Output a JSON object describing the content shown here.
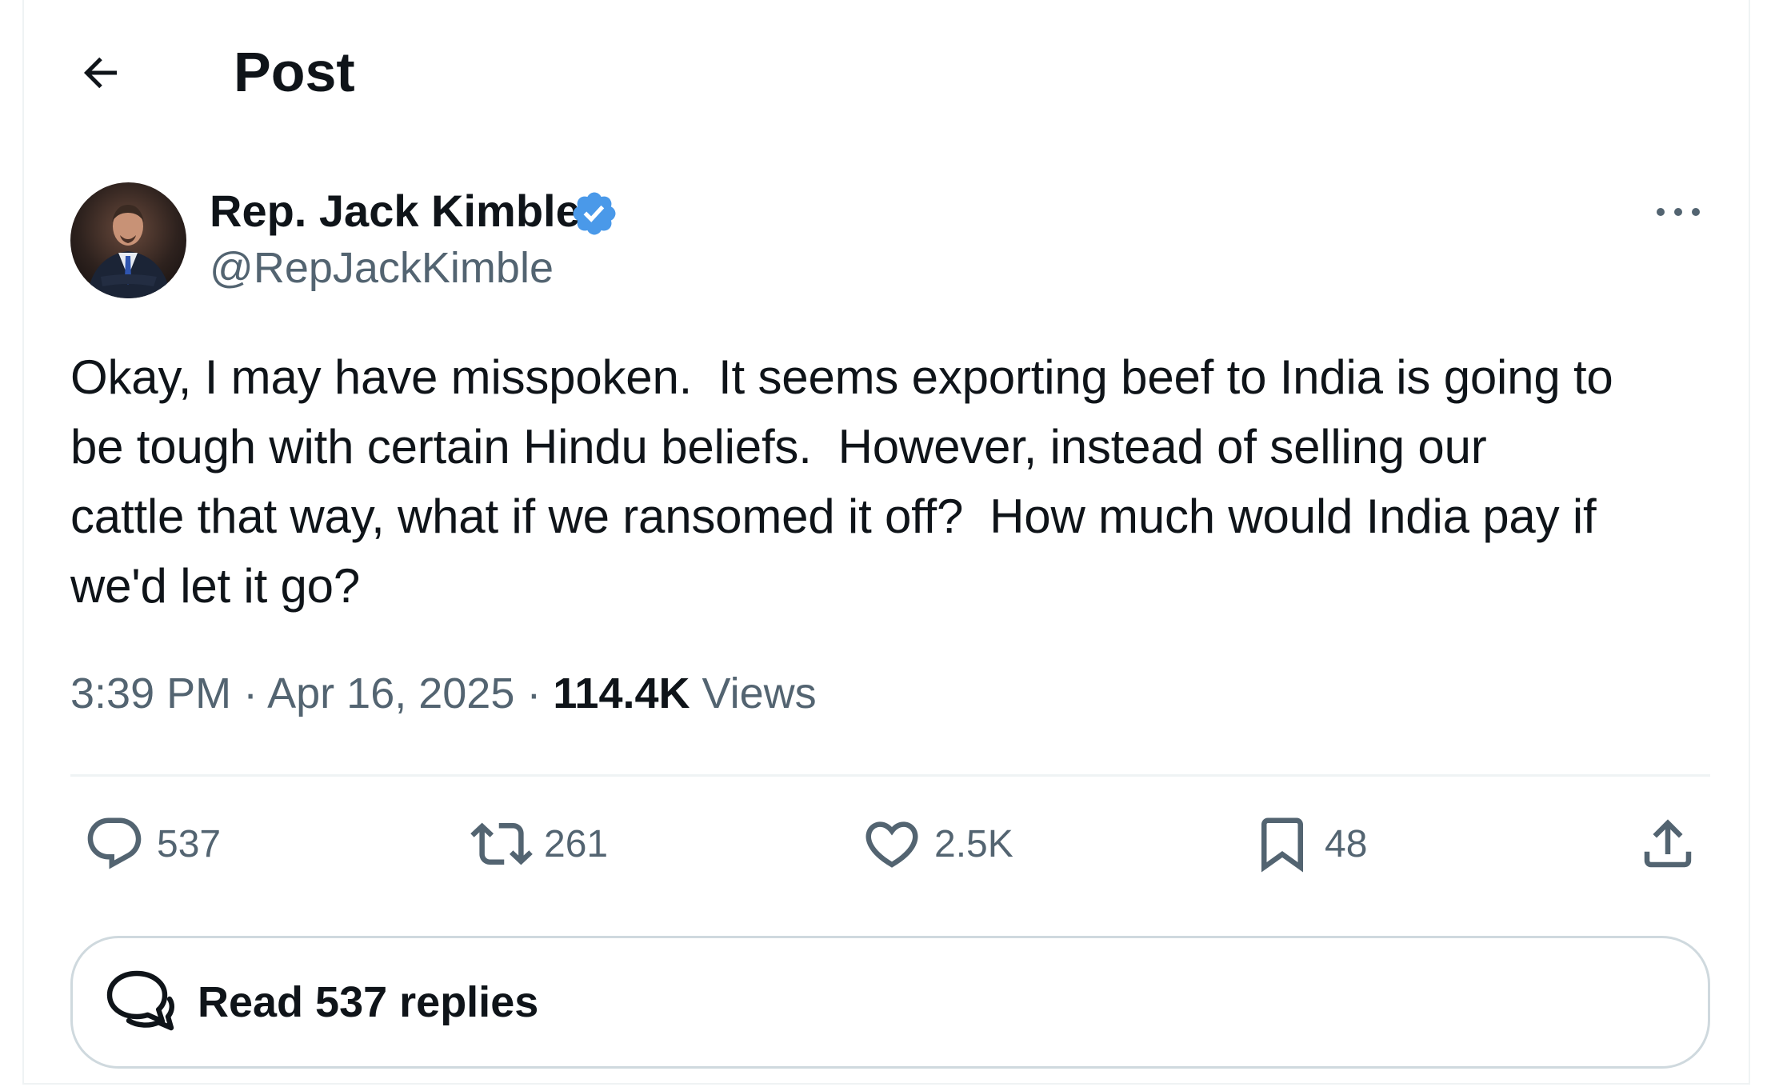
{
  "header": {
    "title": "Post",
    "back_icon": "arrow-left-icon"
  },
  "author": {
    "display_name": "Rep. Jack Kimble",
    "handle": "@RepJackKimble",
    "verified": true,
    "verified_color": "#4a99e9"
  },
  "tweet": {
    "text": "Okay, I may have misspoken.  It seems exporting beef to India is going to\nbe tough with certain Hindu beliefs.  However, instead of selling our\ncattle that way, what if we ransomed it off?  How much would India pay if\nwe'd let it go?",
    "time": "3:39 PM",
    "separator": " · ",
    "date": "Apr 16, 2025",
    "views_count": "114.4K",
    "views_label": "Views"
  },
  "actions": {
    "replies": "537",
    "reposts": "261",
    "likes": "2.5K",
    "bookmarks": "48"
  },
  "read_replies": {
    "label": "Read 537 replies"
  },
  "colors": {
    "text_primary": "#0f1419",
    "text_secondary": "#536471",
    "border": "#cfd9de",
    "divider": "#eff3f4"
  }
}
